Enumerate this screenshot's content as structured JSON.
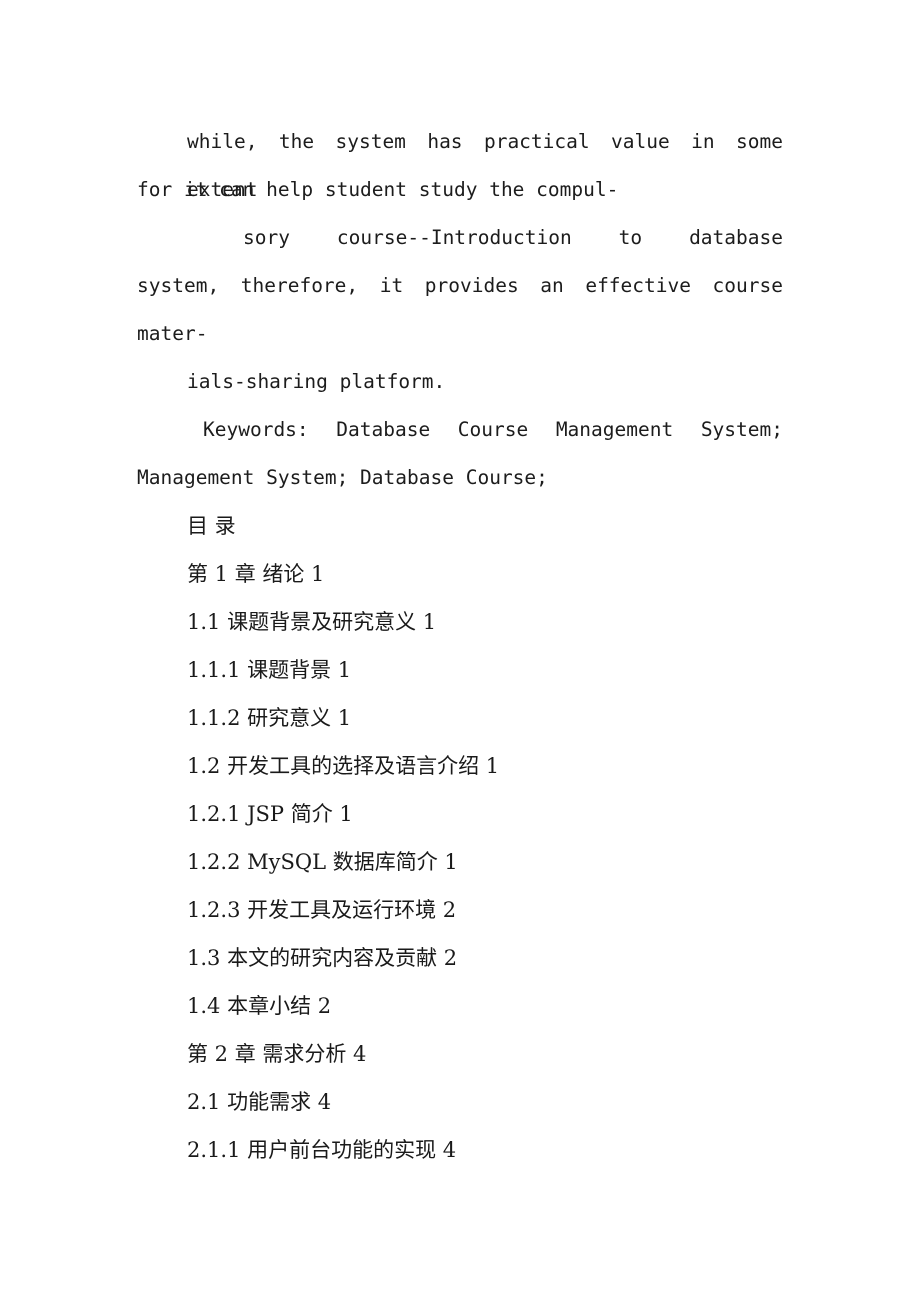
{
  "document": {
    "page_background": "#ffffff",
    "text_color": "#1a1a1a",
    "abstract": {
      "lines": [
        {
          "id": "abs_l1",
          "text": "while, the system has practical value in some extent",
          "indent": "first-line",
          "justified": true
        },
        {
          "id": "abs_l2",
          "text": "for it can help student study the compul-",
          "indent": "none",
          "justified": false
        },
        {
          "id": "abs_l3",
          "text": "sory    course--Introduction    to    database",
          "indent": "deep",
          "justified": true
        },
        {
          "id": "abs_l4",
          "text": "system, therefore, it   provides   an   effective   course",
          "indent": "none",
          "justified": true
        },
        {
          "id": "abs_l5",
          "text": "mater-",
          "indent": "none",
          "justified": false
        },
        {
          "id": "abs_l6",
          "text": "ials-sharing platform.",
          "indent": "first-line",
          "justified": false
        }
      ],
      "keywords": {
        "label": "Keywords:",
        "line1": " Keywords:  Database  Course  Management  System;",
        "line2": "Management System; Database Course;",
        "terms": [
          "Database Course Management System",
          "Management System",
          "Database Course"
        ]
      }
    },
    "toc": {
      "heading": "目 录",
      "entries": [
        {
          "number": "第 1 章",
          "title": "绪论",
          "page": "1",
          "level": 1,
          "text": "第 1 章 绪论 1"
        },
        {
          "number": "1.1",
          "title": "课题背景及研究意义",
          "page": "1",
          "level": 2,
          "text": "1.1 课题背景及研究意义 1"
        },
        {
          "number": "1.1.1",
          "title": "课题背景",
          "page": "1",
          "level": 3,
          "text": "1.1.1 课题背景 1"
        },
        {
          "number": "1.1.2",
          "title": "研究意义",
          "page": "1",
          "level": 3,
          "text": "1.1.2 研究意义 1"
        },
        {
          "number": "1.2",
          "title": "开发工具的选择及语言介绍",
          "page": "1",
          "level": 2,
          "text": "1.2 开发工具的选择及语言介绍 1"
        },
        {
          "number": "1.2.1",
          "title": "JSP 简介",
          "page": "1",
          "level": 3,
          "text": "1.2.1 JSP 简介 1"
        },
        {
          "number": "1.2.2",
          "title": "MySQL 数据库简介",
          "page": "1",
          "level": 3,
          "text": "1.2.2 MySQL 数据库简介 1"
        },
        {
          "number": "1.2.3",
          "title": "开发工具及运行环境",
          "page": "2",
          "level": 3,
          "text": "1.2.3 开发工具及运行环境 2"
        },
        {
          "number": "1.3",
          "title": "本文的研究内容及贡献",
          "page": "2",
          "level": 2,
          "text": "1.3 本文的研究内容及贡献 2"
        },
        {
          "number": "1.4",
          "title": "本章小结",
          "page": "2",
          "level": 2,
          "text": "1.4 本章小结 2"
        },
        {
          "number": "第 2 章",
          "title": "需求分析",
          "page": "4",
          "level": 1,
          "text": "第 2 章 需求分析 4"
        },
        {
          "number": "2.1",
          "title": "功能需求",
          "page": "4",
          "level": 2,
          "text": "2.1 功能需求 4"
        },
        {
          "number": "2.1.1",
          "title": "用户前台功能的实现",
          "page": "4",
          "level": 3,
          "text": "2.1.1 用户前台功能的实现 4"
        }
      ]
    }
  }
}
